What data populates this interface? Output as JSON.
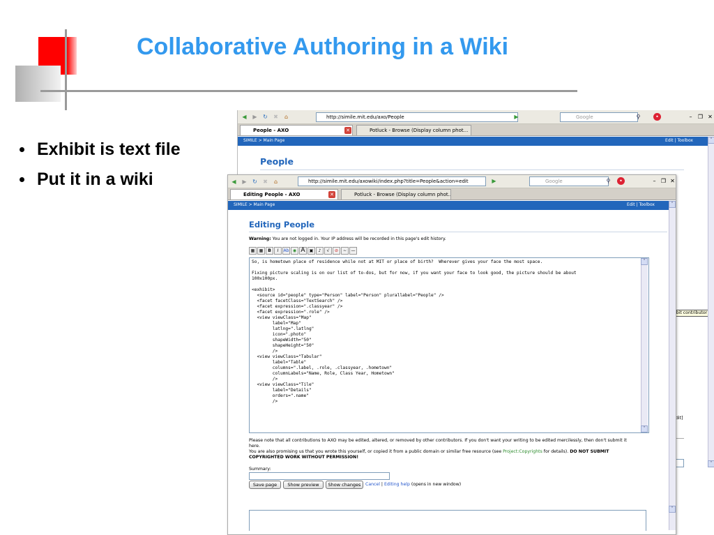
{
  "slide": {
    "title": "Collaborative Authoring in a Wiki",
    "bullets": [
      "Exhibit is text file",
      "Put it in a wiki"
    ]
  },
  "back_window": {
    "url": "http://simile.mit.edu/axo/People",
    "search_placeholder": "Google",
    "tabs": [
      {
        "label": "People - AXO",
        "active": true
      },
      {
        "label": "Potluck - Browse (Display column phot...",
        "active": false
      }
    ],
    "breadcrumb": "SIMILE  >  Main Page",
    "nav_right": "Edit   |   Toolbox",
    "page_heading": "People",
    "tooltip": "ibit contributor",
    "side_text": "dit]"
  },
  "front_window": {
    "url": "http://simile.mit.edu/axowiki/index.php?title=People&action=edit",
    "search_placeholder": "Google",
    "tabs": [
      {
        "label": "Editing People - AXO",
        "active": true
      },
      {
        "label": "Potluck - Browse (Display column phot...",
        "active": false
      }
    ],
    "breadcrumb": "SIMILE  >  Main Page",
    "nav_right": "Edit   |   Toolbox",
    "page_heading": "Editing People",
    "warning_label": "Warning:",
    "warning_text": " You are not logged in. Your IP address will be recorded in this page's edit history.",
    "editor_text": "So, is hometown place of residence while not at MIT or place of birth?  Wherever gives your face the most space.\n\nFixing picture scaling is on our list of to-dos, but for now, if you want your face to look good, the picture should be about\n100x100px.\n\n<exhibit>\n  <source id=\"people\" type=\"Person\" label=\"Person\" plurallabel=\"People\" />\n  <facet facetClass=\"TextSearch\" />\n  <facet expression=\".classyear\" />\n  <facet expression=\".role\" />\n  <view viewClass=\"Map\"\n        label=\"Map\"\n        latlng=\".latlng\"\n        icon=\".photo\"\n        shapeWidth=\"50\"\n        shapeHeight=\"50\"\n        />\n  <view viewClass=\"Tabular\"\n        label=\"Table\"\n        columns=\".label, .role, .classyear, .hometown\"\n        columnLabels=\"Name, Role, Class Year, Hometown\"\n        />\n  <view viewClass=\"Tile\"\n        label=\"Details\"\n        orders=\".name\"\n        />",
    "notice_1": "Please note that all contributions to AXO may be edited, altered, or removed by other contributors. If you don't want your writing to be edited mercilessly, then don't submit it",
    "notice_1b": "here.",
    "notice_2a": "You are also promising us that you wrote this yourself, or copied it from a public domain or similar free resource (see ",
    "notice_2_link": "Project:Copyrights",
    "notice_2b": " for details). ",
    "notice_2_bold": "DO NOT SUBMIT",
    "notice_3_bold": "COPYRIGHTED WORK WITHOUT PERMISSION!",
    "summary_label": "Summary:",
    "save_label": "Save page",
    "preview_label": "Show preview",
    "changes_label": "Show changes",
    "cancel_label": "Cancel",
    "separator": " | ",
    "help_label": "Editing help",
    "help_suffix": " (opens in new window)"
  },
  "colors": {
    "title": "#3399ee",
    "wiki_nav": "#2266bb",
    "deco_red": "#ff0000",
    "deco_gray": "#999999"
  }
}
